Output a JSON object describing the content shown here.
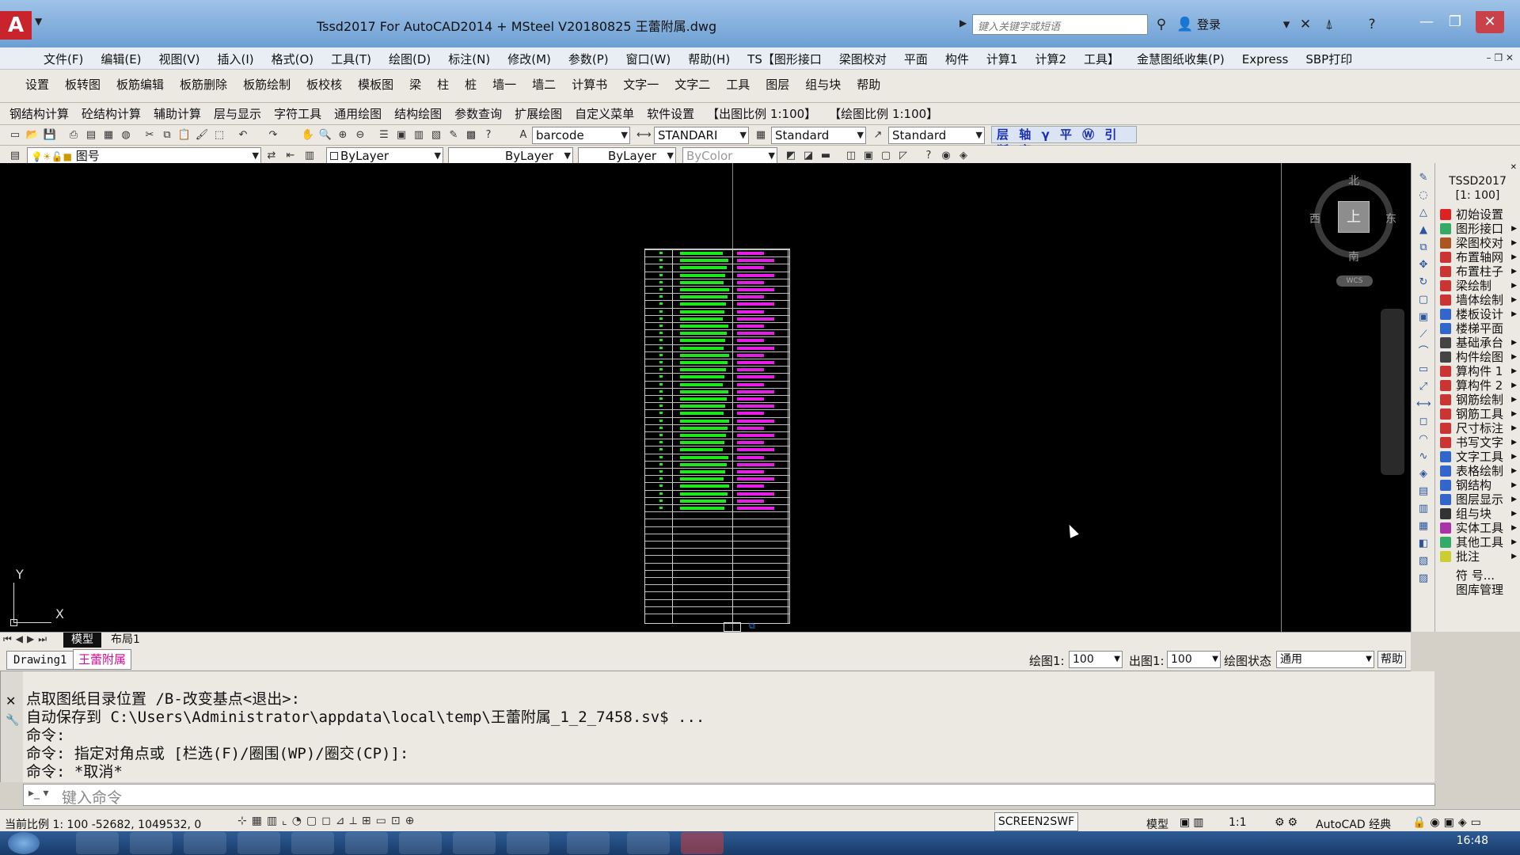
{
  "titlebar": {
    "title": "Tssd2017 For AutoCAD2014 + MSteel V20180825   王蕾附属.dwg",
    "search_placeholder": "键入关键字或短语",
    "login": "登录"
  },
  "menu": [
    "文件(F)",
    "编辑(E)",
    "视图(V)",
    "插入(I)",
    "格式(O)",
    "工具(T)",
    "绘图(D)",
    "标注(N)",
    "修改(M)",
    "参数(P)",
    "窗口(W)",
    "帮助(H)",
    "TS【图形接口",
    "梁图校对",
    "平面",
    "构件",
    "计算1",
    "计算2",
    "工具】",
    "金慧图纸收集(P)",
    "Express",
    "SBP打印"
  ],
  "toolbar1": [
    "设置",
    "板转图",
    "板筋编辑",
    "板筋删除",
    "板筋绘制",
    "板校核",
    "模板图",
    "梁",
    "柱",
    "桩",
    "墙一",
    "墙二",
    "计算书",
    "文字一",
    "文字二",
    "工具",
    "图层",
    "组与块",
    "帮助"
  ],
  "toolbar2": [
    "钢结构计算",
    "砼结构计算",
    "辅助计算",
    "层与显示",
    "字符工具",
    "通用绘图",
    "结构绘图",
    "参数查询",
    "扩展绘图",
    "自定义菜单",
    "软件设置",
    "【出图比例 1:100】",
    "【绘图比例 1:100】"
  ],
  "toolbar3": {
    "text_style": "barcode",
    "dim_style": "STANDARI",
    "table_style": "Standard",
    "multileader_style": "Standard",
    "tssd_icons": "层 轴 γ 平 Ⓦ 引 断 齐"
  },
  "toolbar4": {
    "layer": "图号",
    "color": "ByLayer",
    "linetype": "ByLayer",
    "lineweight": "ByLayer",
    "plotstyle": "ByColor"
  },
  "viewcube": {
    "north": "北",
    "south": "南",
    "east": "东",
    "west": "西",
    "face": "上",
    "wcs": "WCS"
  },
  "ucs": {
    "x": "X",
    "y": "Y"
  },
  "panel": {
    "title": "TSSD2017",
    "scale": "[1: 100]",
    "items": [
      {
        "label": "初始设置",
        "arrow": false,
        "color": "#d22"
      },
      {
        "label": "图形接口",
        "arrow": true,
        "color": "#3a6"
      },
      {
        "label": "梁图校对",
        "arrow": true,
        "color": "#a52"
      },
      {
        "label": "布置轴网",
        "arrow": true,
        "color": "#c33"
      },
      {
        "label": "布置柱子",
        "arrow": true,
        "color": "#c33"
      },
      {
        "label": "梁绘制",
        "arrow": true,
        "color": "#c33"
      },
      {
        "label": "墙体绘制",
        "arrow": true,
        "color": "#c33"
      },
      {
        "label": "楼板设计",
        "arrow": true,
        "color": "#36c"
      },
      {
        "label": "楼梯平面",
        "arrow": false,
        "color": "#36c"
      },
      {
        "label": "基础承台",
        "arrow": true,
        "color": "#444"
      },
      {
        "label": "构件绘图",
        "arrow": true,
        "color": "#444"
      },
      {
        "label": "算构件 1",
        "arrow": true,
        "color": "#c33"
      },
      {
        "label": "算构件 2",
        "arrow": true,
        "color": "#c33"
      },
      {
        "label": "钢筋绘制",
        "arrow": true,
        "color": "#c33"
      },
      {
        "label": "钢筋工具",
        "arrow": true,
        "color": "#c33"
      },
      {
        "label": "尺寸标注",
        "arrow": true,
        "color": "#c33"
      },
      {
        "label": "书写文字",
        "arrow": true,
        "color": "#c33"
      },
      {
        "label": "文字工具",
        "arrow": true,
        "color": "#36c"
      },
      {
        "label": "表格绘制",
        "arrow": true,
        "color": "#36c"
      },
      {
        "label": "钢结构",
        "arrow": true,
        "color": "#36c"
      },
      {
        "label": "图层显示",
        "arrow": true,
        "color": "#36c"
      },
      {
        "label": "组与块",
        "arrow": true,
        "color": "#333"
      },
      {
        "label": "实体工具",
        "arrow": true,
        "color": "#a3a"
      },
      {
        "label": "其他工具",
        "arrow": true,
        "color": "#3a6"
      },
      {
        "label": "批注",
        "arrow": true,
        "color": "#cc3"
      },
      {
        "label": "符 号...",
        "arrow": false,
        "color": ""
      },
      {
        "label": "图库管理",
        "arrow": false,
        "color": ""
      }
    ]
  },
  "layout_tabs": {
    "model": "模型",
    "layout1": "布局1"
  },
  "file_tabs": {
    "drawing1": "Drawing1",
    "active": "王蕾附属"
  },
  "scale_bar": {
    "draw_label": "绘图1:",
    "draw_value": "100",
    "out_label": "出图1:",
    "out_value": "100",
    "state_label": "绘图状态",
    "state_value": "通用",
    "help": "帮助"
  },
  "command": {
    "history": [
      "点取图纸目录位置 /B-改变基点<退出>:",
      "自动保存到 C:\\Users\\Administrator\\appdata\\local\\temp\\王蕾附属_1_2_7458.sv$ ...",
      "命令:",
      "命令: 指定对角点或 [栏选(F)/圈围(WP)/圈交(CP)]:",
      "命令: *取消*"
    ],
    "placeholder": "键入命令"
  },
  "status": {
    "coords": "当前比例 1: 100   -52682, 1049532, 0",
    "screen2swf": "SCREEN2SWF",
    "model": "模型",
    "anno_scale": "1:1",
    "workspace": "AutoCAD 经典"
  },
  "taskbar": {
    "clock": "16:48"
  }
}
